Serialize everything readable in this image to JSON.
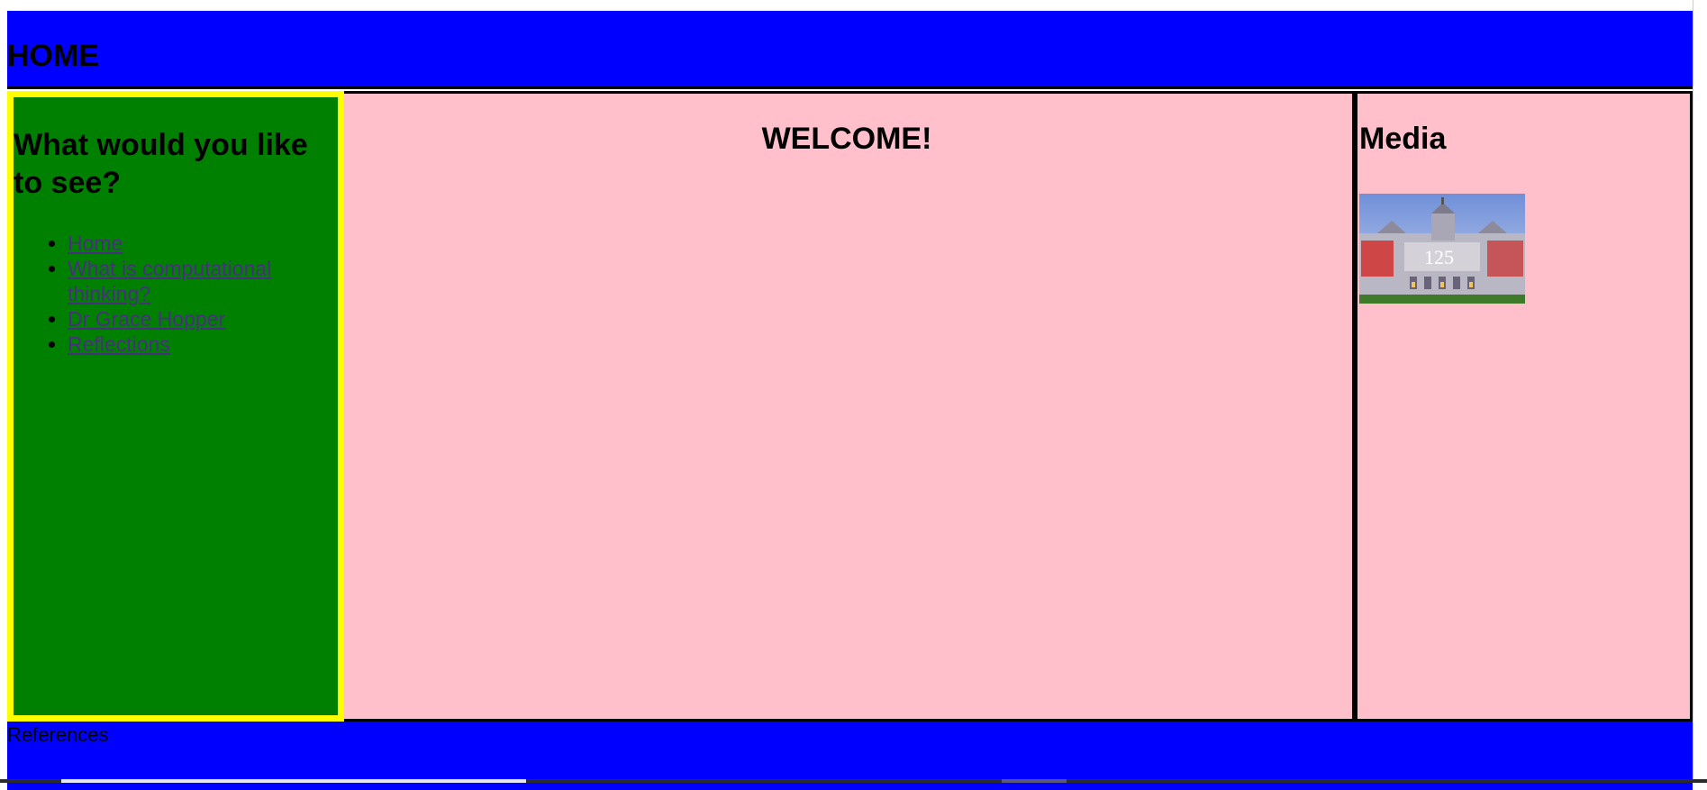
{
  "header": {
    "title": "HOME"
  },
  "nav": {
    "heading": "What would you like to see?",
    "items": [
      {
        "label": "Home"
      },
      {
        "label": "What is computational thinking?"
      },
      {
        "label": "Dr Grace Hopper"
      },
      {
        "label": "Reflections"
      }
    ]
  },
  "main": {
    "heading": "WELCOME!"
  },
  "aside": {
    "heading": "Media",
    "image_text": "125"
  },
  "footer": {
    "text": "References"
  },
  "colors": {
    "header_bg": "#0000ff",
    "nav_bg": "#008000",
    "nav_border": "#ffff00",
    "content_bg": "#ffc0cb",
    "link": "#4b2e83"
  }
}
